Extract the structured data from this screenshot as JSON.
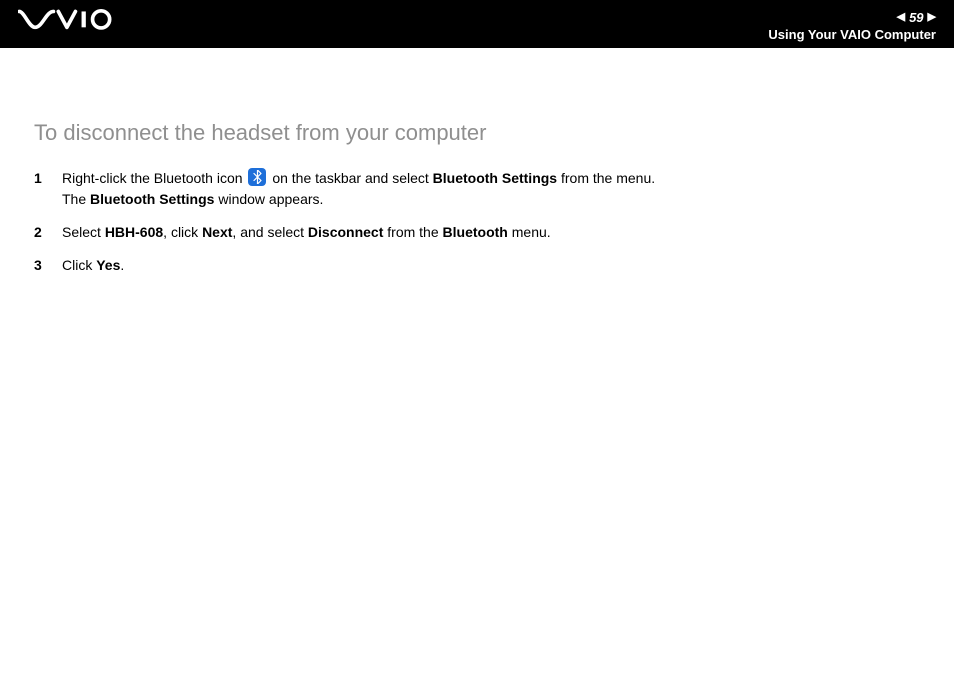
{
  "header": {
    "page_number": "59",
    "section_title": "Using Your VAIO Computer"
  },
  "heading": "To disconnect the headset from your computer",
  "steps": [
    {
      "pre_icon": "Right-click the Bluetooth icon ",
      "post_icon_a": " on the taskbar and select ",
      "bold1": "Bluetooth Settings",
      "post_bold1": " from the menu.",
      "line2_pre": "The ",
      "line2_bold": "Bluetooth Settings",
      "line2_post": " window appears."
    },
    {
      "pre": "Select ",
      "bold1": "HBH-608",
      "mid1": ", click ",
      "bold2": "Next",
      "mid2": ", and select ",
      "bold3": "Disconnect",
      "mid3": " from the ",
      "bold4": "Bluetooth",
      "post": " menu."
    },
    {
      "pre": "Click ",
      "bold1": "Yes",
      "post": "."
    }
  ]
}
